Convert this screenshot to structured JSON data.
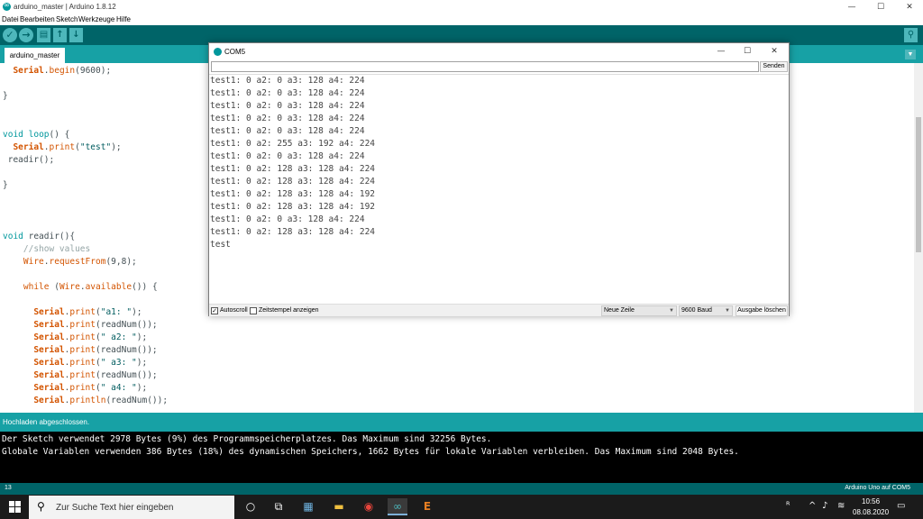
{
  "window": {
    "title": "arduino_master | Arduino 1.8.12",
    "minimize": "—",
    "maximize": "☐",
    "close": "✕"
  },
  "menu": [
    "Datei",
    "Bearbeiten",
    "Sketch",
    "Werkzeuge",
    "Hilfe"
  ],
  "toolbar": {
    "verify": "✓",
    "upload": "→",
    "new": "▤",
    "open": "↑",
    "save": "↓",
    "monitor": "⚲"
  },
  "tab": {
    "label": "arduino_master",
    "menu": "▼"
  },
  "code": [
    "  Serial.begin(9600);",
    "",
    "}",
    "",
    "",
    "void loop() {",
    "  Serial.print(\"test\");",
    " readir();",
    "",
    "}",
    "",
    "",
    "",
    "void readir(){",
    "    //show values",
    "    Wire.requestFrom(9,8);",
    "",
    "    while (Wire.available()) {",
    "",
    "      Serial.print(\"a1: \");",
    "      Serial.print(readNum());",
    "      Serial.print(\" a2: \");",
    "      Serial.print(readNum());",
    "      Serial.print(\" a3: \");",
    "      Serial.print(readNum());",
    "      Serial.print(\" a4: \");",
    "      Serial.println(readNum());"
  ],
  "status": {
    "text": "Hochladen abgeschlossen."
  },
  "console": [
    "Der Sketch verwendet 2978 Bytes (9%) des Programmspeicherplatzes. Das Maximum sind 32256 Bytes.",
    "Globale Variablen verwenden 386 Bytes (18%) des dynamischen Speichers, 1662 Bytes für lokale Variablen verbleiben. Das Maximum sind 2048 Bytes."
  ],
  "boardbar": {
    "line": "13",
    "board": "Arduino Uno auf COM5"
  },
  "serial": {
    "title": "COM5",
    "send": "Senden",
    "input_value": "",
    "lines": [
      "test1: 0 a2: 0 a3: 128 a4: 224",
      "test1: 0 a2: 0 a3: 128 a4: 224",
      "test1: 0 a2: 0 a3: 128 a4: 224",
      "test1: 0 a2: 0 a3: 128 a4: 224",
      "test1: 0 a2: 0 a3: 128 a4: 224",
      "test1: 0 a2: 255 a3: 192 a4: 224",
      "test1: 0 a2: 0 a3: 128 a4: 224",
      "test1: 0 a2: 128 a3: 128 a4: 224",
      "test1: 0 a2: 128 a3: 128 a4: 224",
      "test1: 0 a2: 128 a3: 128 a4: 192",
      "test1: 0 a2: 128 a3: 128 a4: 192",
      "test1: 0 a2: 0 a3: 128 a4: 224",
      "test1: 0 a2: 128 a3: 128 a4: 224",
      "test"
    ],
    "autoscroll": "Autoscroll",
    "timestamp": "Zeitstempel anzeigen",
    "line_ending": "Neue Zeile",
    "baud": "9600 Baud",
    "clear": "Ausgabe löschen",
    "check": "✓"
  },
  "taskbar": {
    "search_placeholder": "Zur Suche Text hier eingeben",
    "time": "10:56",
    "date": "08.08.2020"
  }
}
